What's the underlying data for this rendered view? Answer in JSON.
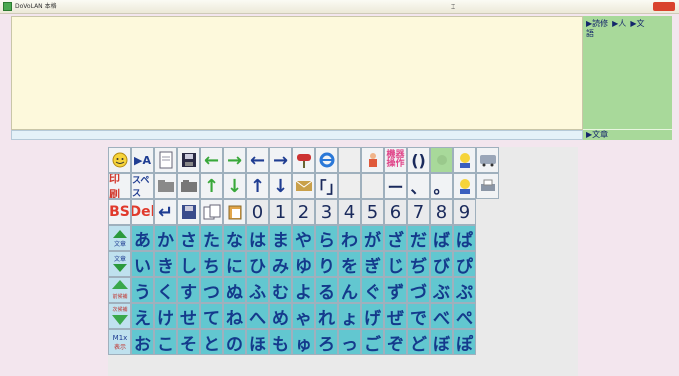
{
  "window": {
    "title": "DoVoLAN 本格"
  },
  "right_panel": {
    "links": [
      "▶読修",
      "▶人",
      "▶文",
      "語"
    ],
    "footer": "▶文章"
  },
  "toolbar_row1": {
    "labels": [
      "▶A",
      "「」",
      "()",
      "ー",
      "、",
      "。"
    ],
    "device_label": "機器操作"
  },
  "toolbar_row2": {
    "print_label": "印刷",
    "space_label": "スペス",
    "bracket_label": "「」",
    "dash_label": "ー",
    "comma_label": "、",
    "period_label": "。"
  },
  "keys_row3": {
    "bs": "BS",
    "del": "Del",
    "numbers": [
      "0",
      "1",
      "2",
      "3",
      "4",
      "5",
      "6",
      "7",
      "8",
      "9"
    ]
  },
  "kana_rows": [
    [
      "あ",
      "か",
      "さ",
      "た",
      "な",
      "は",
      "ま",
      "や",
      "ら",
      "わ",
      "が",
      "ざ",
      "だ",
      "ば",
      "ぱ"
    ],
    [
      "い",
      "き",
      "し",
      "ち",
      "に",
      "ひ",
      "み",
      "ゆ",
      "り",
      "を",
      "ぎ",
      "じ",
      "ぢ",
      "び",
      "ぴ"
    ],
    [
      "う",
      "く",
      "す",
      "つ",
      "ぬ",
      "ふ",
      "む",
      "よ",
      "る",
      "ん",
      "ぐ",
      "ず",
      "づ",
      "ぶ",
      "ぷ"
    ],
    [
      "え",
      "け",
      "せ",
      "て",
      "ね",
      "へ",
      "め",
      "ゃ",
      "れ",
      "ょ",
      "げ",
      "ぜ",
      "で",
      "べ",
      "ぺ"
    ],
    [
      "お",
      "こ",
      "そ",
      "と",
      "の",
      "ほ",
      "も",
      "ゅ",
      "ろ",
      "っ",
      "ご",
      "ぞ",
      "ど",
      "ぼ",
      "ぽ"
    ]
  ],
  "side_labels": [
    "文章",
    "文章",
    "前候補",
    "次候補",
    "表示"
  ]
}
